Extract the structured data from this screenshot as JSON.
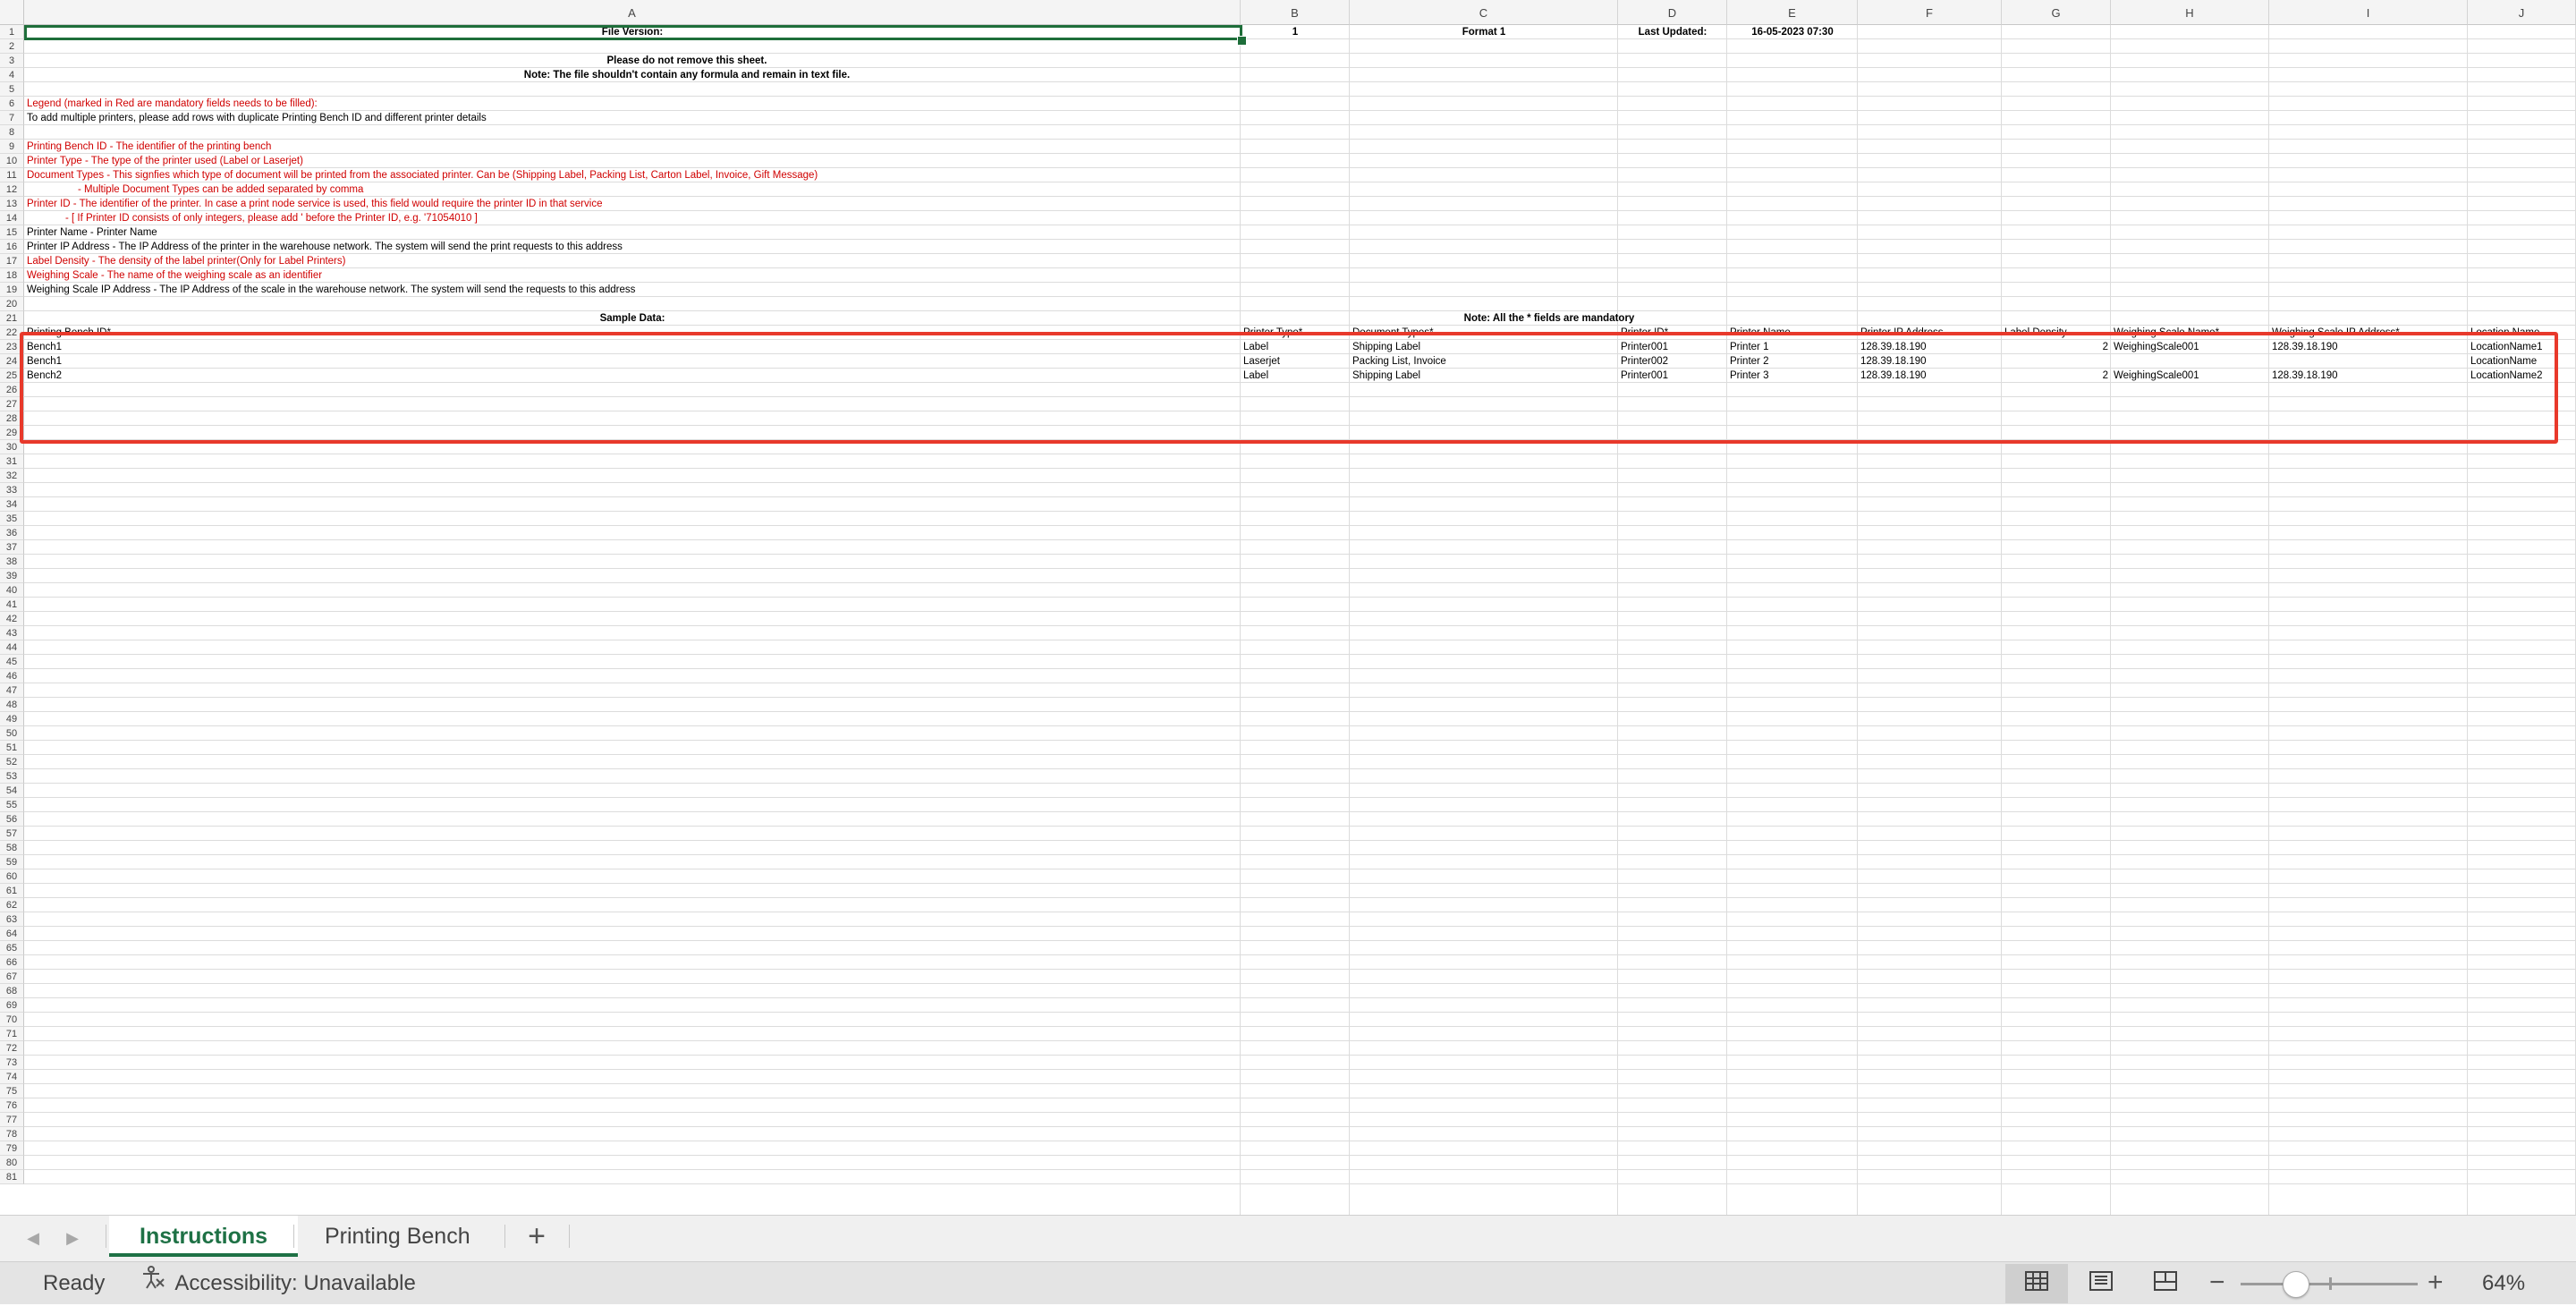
{
  "sheet": {
    "columns": [
      "A",
      "B",
      "C",
      "D",
      "E",
      "F",
      "G",
      "H",
      "I",
      "J"
    ],
    "row_count": 81,
    "rows": [
      {
        "row": 1,
        "cells": [
          {
            "col": "A",
            "text": "File Version:",
            "style": "bold center"
          },
          {
            "col": "B",
            "text": "1",
            "style": "bold center"
          },
          {
            "col": "C",
            "text": "Format 1",
            "style": "bold center"
          },
          {
            "col": "D",
            "text": "Last Updated:",
            "style": "bold center"
          },
          {
            "col": "E",
            "text": "16-05-2023 07:30",
            "style": "bold center"
          }
        ]
      },
      {
        "row": 3,
        "cells": [
          {
            "col": "A",
            "text": "Please do not remove this sheet.",
            "style": "bold center",
            "span": "B"
          }
        ]
      },
      {
        "row": 4,
        "cells": [
          {
            "col": "A",
            "text": "Note: The file shouldn't contain any formula and remain in text file.",
            "style": "bold center",
            "span": "B"
          }
        ]
      },
      {
        "row": 6,
        "cells": [
          {
            "col": "A",
            "text": "Legend (marked in Red are mandatory fields needs to be filled):",
            "style": "red"
          }
        ]
      },
      {
        "row": 7,
        "cells": [
          {
            "col": "A",
            "text": "To add multiple printers, please add rows with duplicate Printing Bench ID and different printer details",
            "style": ""
          }
        ]
      },
      {
        "row": 9,
        "cells": [
          {
            "col": "A",
            "text": "Printing Bench ID - The identifier of the printing bench",
            "style": "red"
          }
        ]
      },
      {
        "row": 10,
        "cells": [
          {
            "col": "A",
            "text": "Printer Type - The type of the printer used (Label or Laserjet)",
            "style": "red"
          }
        ]
      },
      {
        "row": 11,
        "cells": [
          {
            "col": "A",
            "text": "Document Types - This signfies which type of document will be printed from the associated printer. Can be (Shipping Label, Packing List, Carton Label, Invoice, Gift Message)",
            "style": "red"
          }
        ]
      },
      {
        "row": 12,
        "cells": [
          {
            "col": "A",
            "text": "- Multiple Document Types can be added separated by comma",
            "style": "red indent2"
          }
        ]
      },
      {
        "row": 13,
        "cells": [
          {
            "col": "A",
            "text": "Printer ID - The identifier of the printer. In case a print node service is used, this field would require the printer ID in that service",
            "style": "red"
          }
        ]
      },
      {
        "row": 14,
        "cells": [
          {
            "col": "A",
            "text": "- [ If Printer ID consists of only integers, please add ' before the Printer ID, e.g. '71054010 ]",
            "style": "red indent1"
          }
        ]
      },
      {
        "row": 15,
        "cells": [
          {
            "col": "A",
            "text": "Printer Name - Printer Name",
            "style": ""
          }
        ]
      },
      {
        "row": 16,
        "cells": [
          {
            "col": "A",
            "text": "Printer IP Address - The IP Address of the printer in the warehouse network. The system will send the print requests to this address",
            "style": ""
          }
        ]
      },
      {
        "row": 17,
        "cells": [
          {
            "col": "A",
            "text": "Label Density - The density of the label printer(Only for Label Printers)",
            "style": "red"
          }
        ]
      },
      {
        "row": 18,
        "cells": [
          {
            "col": "A",
            "text": "Weighing Scale - The name of the weighing scale as an identifier",
            "style": "red"
          }
        ]
      },
      {
        "row": 19,
        "cells": [
          {
            "col": "A",
            "text": "Weighing Scale IP Address - The IP Address of the scale in the warehouse network. The system will send the requests to this address",
            "style": ""
          }
        ]
      },
      {
        "row": 21,
        "cells": [
          {
            "col": "A",
            "text": "Sample Data:",
            "style": "bold center"
          },
          {
            "col": "B",
            "text": "Note: All the * fields are mandatory",
            "style": "bold center",
            "span": "E"
          }
        ]
      },
      {
        "row": 22,
        "cells": [
          {
            "col": "A",
            "text": "Printing Bench ID*",
            "style": ""
          },
          {
            "col": "B",
            "text": "Printer Type*",
            "style": ""
          },
          {
            "col": "C",
            "text": "Document Types*",
            "style": ""
          },
          {
            "col": "D",
            "text": "Printer ID*",
            "style": ""
          },
          {
            "col": "E",
            "text": "Printer Name",
            "style": ""
          },
          {
            "col": "F",
            "text": "Printer IP Address",
            "style": ""
          },
          {
            "col": "G",
            "text": "Label Density",
            "style": ""
          },
          {
            "col": "H",
            "text": "Weighing Scale Name*",
            "style": ""
          },
          {
            "col": "I",
            "text": "Weighing Scale IP Address*",
            "style": ""
          },
          {
            "col": "J",
            "text": "Location Name",
            "style": ""
          }
        ]
      },
      {
        "row": 23,
        "cells": [
          {
            "col": "A",
            "text": "Bench1",
            "style": ""
          },
          {
            "col": "B",
            "text": "Label",
            "style": ""
          },
          {
            "col": "C",
            "text": "Shipping Label",
            "style": ""
          },
          {
            "col": "D",
            "text": "Printer001",
            "style": ""
          },
          {
            "col": "E",
            "text": "Printer 1",
            "style": ""
          },
          {
            "col": "F",
            "text": "128.39.18.190",
            "style": ""
          },
          {
            "col": "G",
            "text": "2",
            "style": "right"
          },
          {
            "col": "H",
            "text": "WeighingScale001",
            "style": ""
          },
          {
            "col": "I",
            "text": "128.39.18.190",
            "style": ""
          },
          {
            "col": "J",
            "text": "LocationName1",
            "style": ""
          }
        ]
      },
      {
        "row": 24,
        "cells": [
          {
            "col": "A",
            "text": "Bench1",
            "style": ""
          },
          {
            "col": "B",
            "text": "Laserjet",
            "style": ""
          },
          {
            "col": "C",
            "text": "Packing List, Invoice",
            "style": ""
          },
          {
            "col": "D",
            "text": "Printer002",
            "style": ""
          },
          {
            "col": "E",
            "text": "Printer 2",
            "style": ""
          },
          {
            "col": "F",
            "text": "128.39.18.190",
            "style": ""
          },
          {
            "col": "J",
            "text": "LocationName",
            "style": ""
          }
        ]
      },
      {
        "row": 25,
        "cells": [
          {
            "col": "A",
            "text": "Bench2",
            "style": ""
          },
          {
            "col": "B",
            "text": "Label",
            "style": ""
          },
          {
            "col": "C",
            "text": "Shipping Label",
            "style": ""
          },
          {
            "col": "D",
            "text": "Printer001",
            "style": ""
          },
          {
            "col": "E",
            "text": "Printer 3",
            "style": ""
          },
          {
            "col": "F",
            "text": "128.39.18.190",
            "style": ""
          },
          {
            "col": "G",
            "text": "2",
            "style": "right"
          },
          {
            "col": "H",
            "text": "WeighingScale001",
            "style": ""
          },
          {
            "col": "I",
            "text": "128.39.18.190",
            "style": ""
          },
          {
            "col": "J",
            "text": "LocationName2",
            "style": ""
          }
        ]
      }
    ]
  },
  "tabs": [
    {
      "label": "Instructions",
      "active": true
    },
    {
      "label": "Printing Bench",
      "active": false
    }
  ],
  "add_sheet_label": "+",
  "status": {
    "ready": "Ready",
    "accessibility": "Accessibility: Unavailable",
    "zoom": "64%"
  },
  "colors": {
    "accent": "#1e7145",
    "mandatory_text": "#d00000",
    "annotation": "#e8392b"
  },
  "icons": {
    "accessibility": "accessibility-icon",
    "normal_view": "normal-view-icon",
    "page_layout": "page-layout-icon",
    "page_break": "page-break-preview-icon"
  }
}
